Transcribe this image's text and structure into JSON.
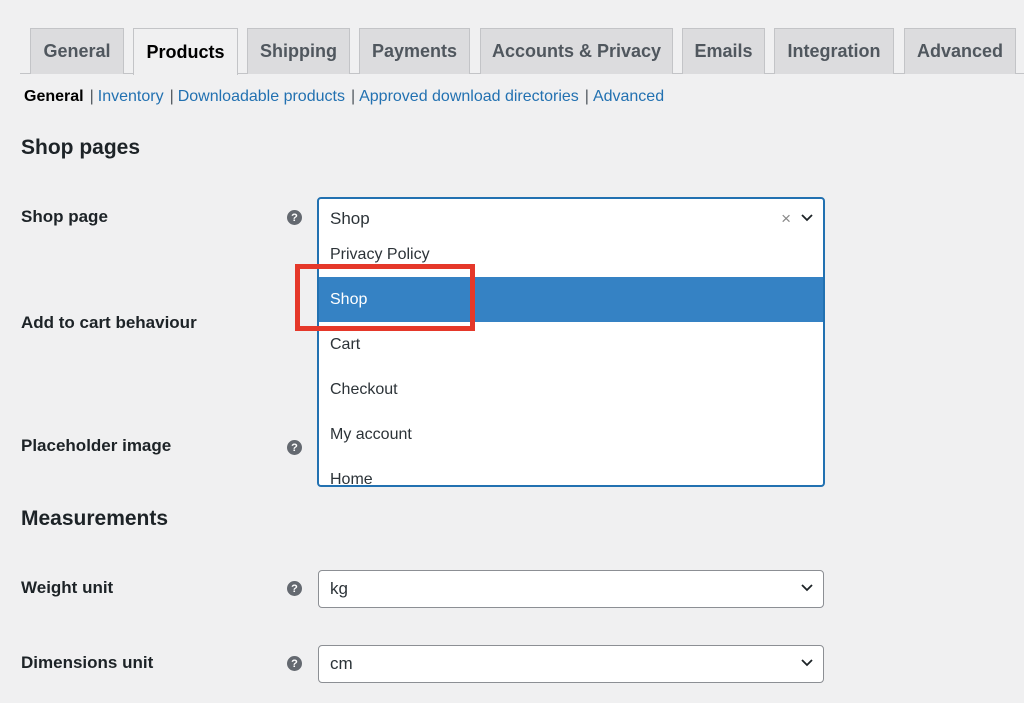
{
  "tabs": [
    {
      "label": "General"
    },
    {
      "label": "Products"
    },
    {
      "label": "Shipping"
    },
    {
      "label": "Payments"
    },
    {
      "label": "Accounts & Privacy"
    },
    {
      "label": "Emails"
    },
    {
      "label": "Integration"
    },
    {
      "label": "Advanced"
    }
  ],
  "subnav": {
    "current": "General",
    "links": [
      "Inventory",
      "Downloadable products",
      "Approved download directories",
      "Advanced"
    ]
  },
  "sections": {
    "shop_pages": "Shop pages",
    "measurements": "Measurements"
  },
  "fields": {
    "shop_page": {
      "label": "Shop page",
      "value": "Shop",
      "clear": "×"
    },
    "add_to_cart": {
      "label": "Add to cart behaviour"
    },
    "placeholder": {
      "label": "Placeholder image"
    },
    "weight": {
      "label": "Weight unit",
      "value": "kg"
    },
    "dimensions": {
      "label": "Dimensions unit",
      "value": "cm"
    }
  },
  "dropdown": {
    "options": [
      "Privacy Policy",
      "Shop",
      "Cart",
      "Checkout",
      "My account",
      "Home"
    ],
    "highlighted": "Shop"
  },
  "help_glyph": "?",
  "colors": {
    "accent": "#2271b1",
    "highlight": "#3582c4",
    "annotation": "#e5382a"
  }
}
